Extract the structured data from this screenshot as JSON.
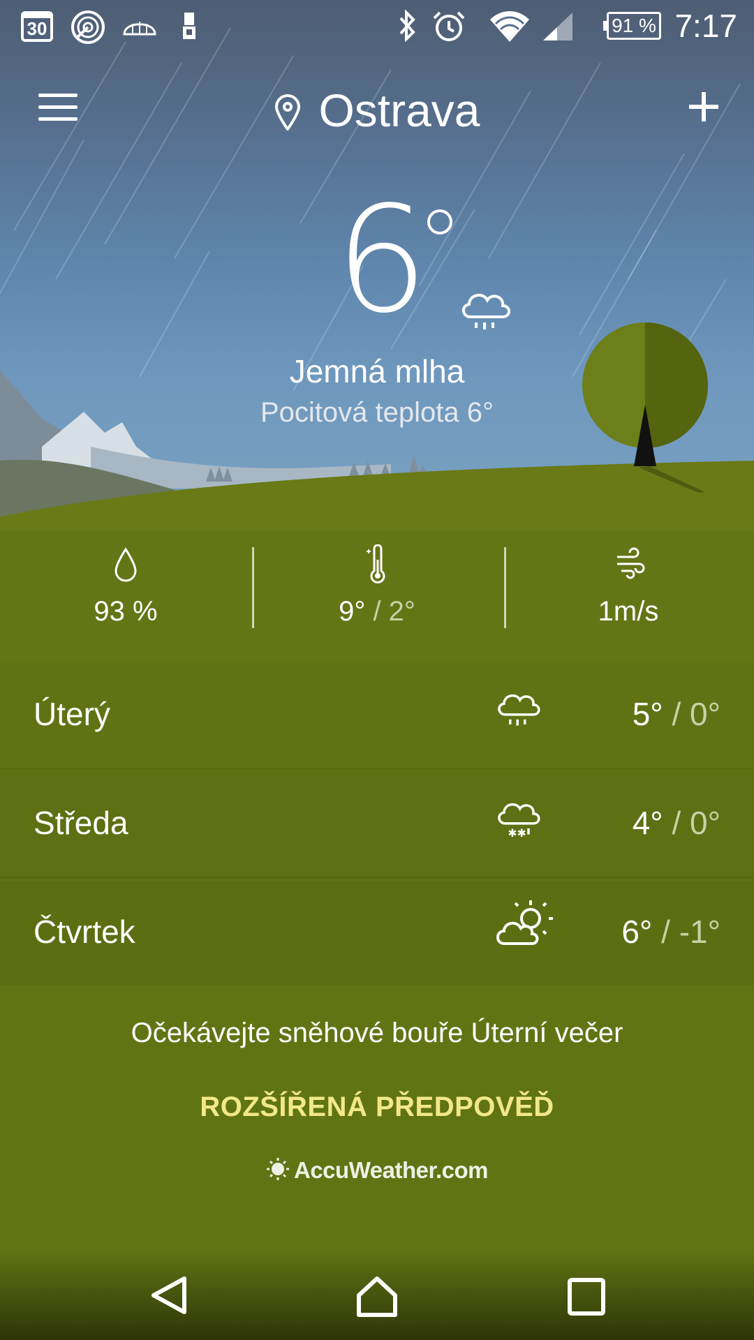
{
  "status_bar": {
    "notification_icons": [
      "calendar-30-icon",
      "radar-icon",
      "cloud-igloo-icon",
      "sim-card-icon"
    ],
    "date_badge": "30",
    "system_icons": [
      "bluetooth-icon",
      "alarm-icon",
      "wifi-icon",
      "signal-icon"
    ],
    "battery": "91 %",
    "time": "7:17"
  },
  "header": {
    "city": "Ostrava",
    "menu_icon": "hamburger-menu-icon",
    "location_icon": "location-pin-icon",
    "add_icon": "plus-icon"
  },
  "current": {
    "temperature": "6",
    "condition": "Jemná mlha",
    "feels_like": "Pocitová teplota 6°",
    "icon": "cloud-rain-icon"
  },
  "stats": {
    "humidity": "93 %",
    "temp_high": "9°",
    "temp_sep": " / ",
    "temp_low": "2°",
    "wind": "1m/s"
  },
  "forecast": [
    {
      "day": "Úterý",
      "icon": "cloud-rain-icon",
      "high": "5°",
      "low": "0°"
    },
    {
      "day": "Středa",
      "icon": "cloud-snow-icon",
      "high": "4°",
      "low": "0°"
    },
    {
      "day": "Čtvrtek",
      "icon": "partly-sunny-icon",
      "high": "6°",
      "low": "-1°"
    }
  ],
  "forecast_sep": " / ",
  "alert": "Očekávejte sněhové bouře Úterní večer",
  "extended_link": "ROZŠÍŘENÁ PŘEDPOVĚĎ",
  "brand": "AccuWeather.com",
  "colors": {
    "ground": "#617414",
    "link": "#f2e88a",
    "sky_top": "#4e5d73",
    "sky_bottom": "#7aa2c2"
  }
}
